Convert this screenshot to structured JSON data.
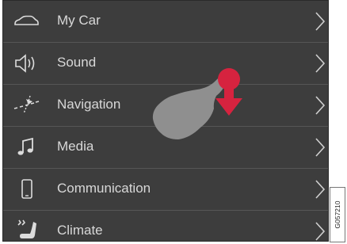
{
  "menu": {
    "items": [
      {
        "label": "My Car",
        "icon": "car-icon"
      },
      {
        "label": "Sound",
        "icon": "speaker-icon"
      },
      {
        "label": "Navigation",
        "icon": "navigation-icon"
      },
      {
        "label": "Media",
        "icon": "music-note-icon"
      },
      {
        "label": "Communication",
        "icon": "phone-icon"
      },
      {
        "label": "Climate",
        "icon": "climate-seat-icon"
      }
    ]
  },
  "gesture": {
    "icon": "swipe-down-gesture-icon",
    "hand_color": "#8f8f8f",
    "touch_color": "#d6233f",
    "arrow_color": "#d6233f"
  },
  "image_code": "G057210",
  "colors": {
    "background": "#3d3d3d",
    "text": "#d8d8d8",
    "divider": "#565656"
  }
}
